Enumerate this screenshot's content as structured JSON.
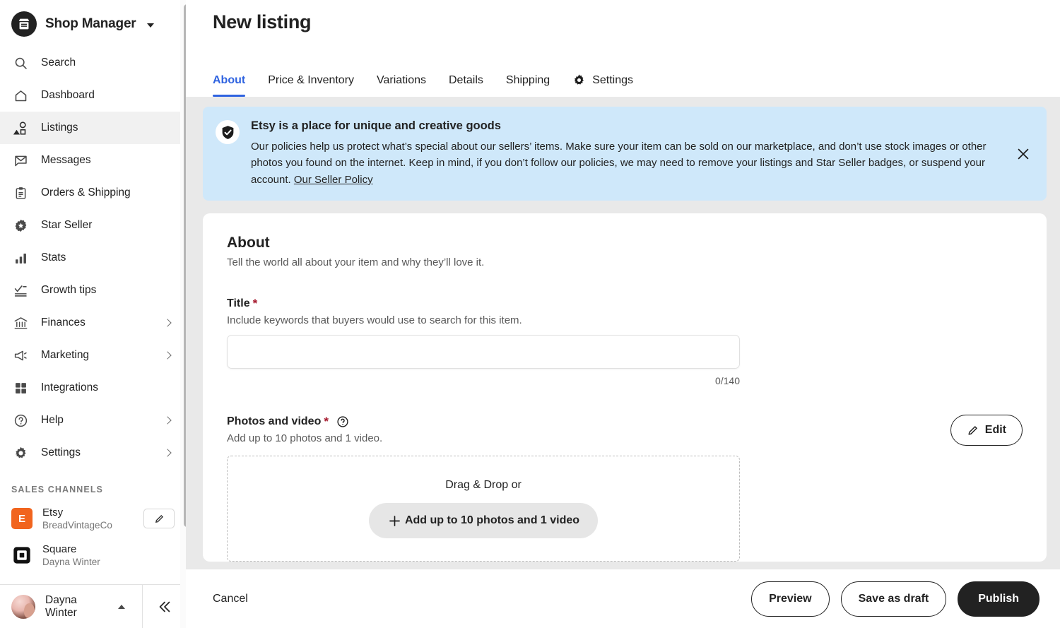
{
  "sidebar": {
    "brand": {
      "name": "Shop Manager",
      "logo_icon": "storefront-icon",
      "caret_icon": "caret-down-icon"
    },
    "items": [
      {
        "label": "Search",
        "icon": "search-icon",
        "active": false,
        "chevron": false
      },
      {
        "label": "Dashboard",
        "icon": "home-icon",
        "active": false,
        "chevron": false
      },
      {
        "label": "Listings",
        "icon": "shapes-icon",
        "active": true,
        "chevron": false
      },
      {
        "label": "Messages",
        "icon": "envelope-icon",
        "active": false,
        "chevron": false
      },
      {
        "label": "Orders & Shipping",
        "icon": "clipboard-icon",
        "active": false,
        "chevron": false
      },
      {
        "label": "Star Seller",
        "icon": "star-badge-icon",
        "active": false,
        "chevron": false
      },
      {
        "label": "Stats",
        "icon": "bar-chart-icon",
        "active": false,
        "chevron": false
      },
      {
        "label": "Growth tips",
        "icon": "checklist-icon",
        "active": false,
        "chevron": false
      },
      {
        "label": "Finances",
        "icon": "bank-icon",
        "active": false,
        "chevron": true
      },
      {
        "label": "Marketing",
        "icon": "megaphone-icon",
        "active": false,
        "chevron": true
      },
      {
        "label": "Integrations",
        "icon": "grid-icon",
        "active": false,
        "chevron": false
      },
      {
        "label": "Help",
        "icon": "question-icon",
        "active": false,
        "chevron": true
      },
      {
        "label": "Settings",
        "icon": "gear-icon",
        "active": false,
        "chevron": true
      }
    ],
    "sales_channels_label": "SALES CHANNELS",
    "channels": [
      {
        "name": "Etsy",
        "account": "BreadVintageCo",
        "icon": "etsy-logo-icon",
        "badge_letter": "E",
        "badge_color": "#F1641E",
        "edit_icon": "pencil-icon",
        "has_edit": true
      },
      {
        "name": "Square",
        "account": "Dayna Winter",
        "icon": "square-logo-icon",
        "has_edit": false
      }
    ],
    "user": {
      "name": "Dayna Winter",
      "avatar_icon": "avatar",
      "caret_icon": "caret-up-icon"
    },
    "collapse_icon": "double-chevron-left-icon"
  },
  "header": {
    "title": "New listing",
    "tabs": [
      {
        "label": "About",
        "active": true,
        "icon": null
      },
      {
        "label": "Price & Inventory",
        "active": false,
        "icon": null
      },
      {
        "label": "Variations",
        "active": false,
        "icon": null
      },
      {
        "label": "Details",
        "active": false,
        "icon": null
      },
      {
        "label": "Shipping",
        "active": false,
        "icon": null
      },
      {
        "label": "Settings",
        "active": false,
        "icon": "gear-icon"
      }
    ],
    "active_color": "#2F63E0"
  },
  "banner": {
    "icon": "shield-check-icon",
    "background": "#CFE8FA",
    "title": "Etsy is a place for unique and creative goods",
    "text": "Our policies help us protect what’s special about our sellers’ items. Make sure your item can be sold on our marketplace, and don’t use stock images or other photos you found on the internet. Keep in mind, if you don’t follow our policies, we may need to remove your listings and Star Seller badges, or suspend your account. ",
    "link_text": "Our Seller Policy",
    "close_icon": "close-icon"
  },
  "about_card": {
    "title": "About",
    "subtitle": "Tell the world all about your item and why they’ll love it.",
    "title_field": {
      "label": "Title",
      "required_mark": "*",
      "hint": "Include keywords that buyers would use to search for this item.",
      "value": "",
      "placeholder": "",
      "counter": "0/140"
    },
    "photos_field": {
      "label": "Photos and video",
      "required_mark": "*",
      "help_icon": "question-circle-icon",
      "hint": "Add up to 10 photos and 1 video.",
      "edit_button": {
        "label": "Edit",
        "icon": "pencil-icon"
      },
      "dropzone_text": "Drag & Drop or",
      "dropzone_button": {
        "label": "Add up to 10 photos and 1 video",
        "icon": "plus-icon"
      }
    }
  },
  "action_bar": {
    "cancel": "Cancel",
    "preview": "Preview",
    "save_draft": "Save as draft",
    "publish": "Publish"
  }
}
